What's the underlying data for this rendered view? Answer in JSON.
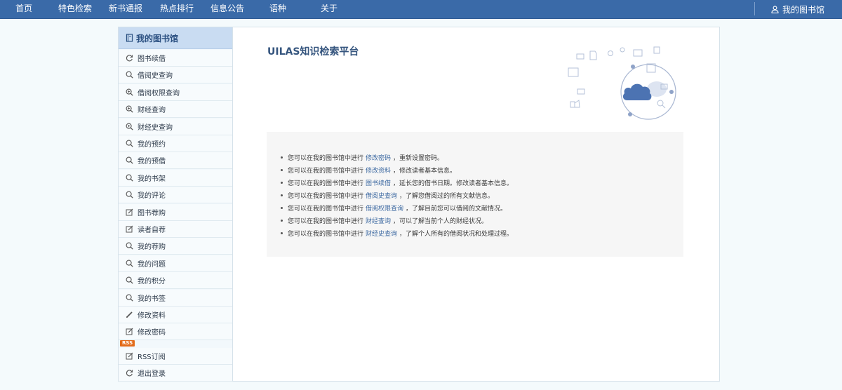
{
  "topnav": {
    "items": [
      "首页",
      "特色检索",
      "新书通报",
      "热点排行",
      "信息公告",
      "语种",
      "关于"
    ],
    "user_label": "我的图书馆"
  },
  "sidebar": {
    "header": "我的图书馆",
    "rss_badge": "RSS",
    "items": [
      {
        "label": "图书续借",
        "icon": "refresh-icon"
      },
      {
        "label": "借阅史查询",
        "icon": "search-icon"
      },
      {
        "label": "借阅权限查询",
        "icon": "search-plus-icon"
      },
      {
        "label": "财经查询",
        "icon": "search-plus-icon"
      },
      {
        "label": "财经史查询",
        "icon": "search-plus-icon"
      },
      {
        "label": "我的预约",
        "icon": "search-icon"
      },
      {
        "label": "我的预借",
        "icon": "search-icon"
      },
      {
        "label": "我的书架",
        "icon": "search-icon"
      },
      {
        "label": "我的评论",
        "icon": "search-icon"
      },
      {
        "label": "图书荐购",
        "icon": "edit-icon"
      },
      {
        "label": "读者自荐",
        "icon": "edit-icon"
      },
      {
        "label": "我的荐购",
        "icon": "search-icon"
      },
      {
        "label": "我的问题",
        "icon": "search-icon"
      },
      {
        "label": "我的积分",
        "icon": "search-icon"
      },
      {
        "label": "我的书签",
        "icon": "search-icon"
      },
      {
        "label": "修改资料",
        "icon": "pencil-icon"
      },
      {
        "label": "修改密码",
        "icon": "edit-icon"
      },
      {
        "label": "RSS订阅",
        "icon": "edit-icon"
      },
      {
        "label": "退出登录",
        "icon": "refresh-icon"
      }
    ]
  },
  "main": {
    "title": "UILAS知识检索平台",
    "info": [
      {
        "prefix": "您可以在我的图书馆中进行",
        "link": "修改密码",
        "suffix": "，重新设置密码。"
      },
      {
        "prefix": "您可以在我的图书馆中进行",
        "link": "修改资料",
        "suffix": "，修改读者基本信息。"
      },
      {
        "prefix": "您可以在我的图书馆中进行",
        "link": "图书续借",
        "suffix": "，延长您的借书日期。修改读者基本信息。"
      },
      {
        "prefix": "您可以在我的图书馆中进行",
        "link": "借阅史查询",
        "suffix": "，了解您借阅过的所有文献信息。"
      },
      {
        "prefix": "您可以在我的图书馆中进行",
        "link": "借阅权限查询",
        "suffix": "，了解目前您可以借阅的文献情况。"
      },
      {
        "prefix": "您可以在我的图书馆中进行",
        "link": "财经查询",
        "suffix": "，可以了解当前个人的财经状况。"
      },
      {
        "prefix": "您可以在我的图书馆中进行",
        "link": "财经史查询",
        "suffix": "，了解个人所有的借阅状况和处理过程。"
      }
    ]
  },
  "colors": {
    "nav_bg": "#3a6aa8",
    "sidebar_header_bg": "#c9dcf2",
    "link": "#3e6aa2",
    "rss": "#e36b1a"
  }
}
